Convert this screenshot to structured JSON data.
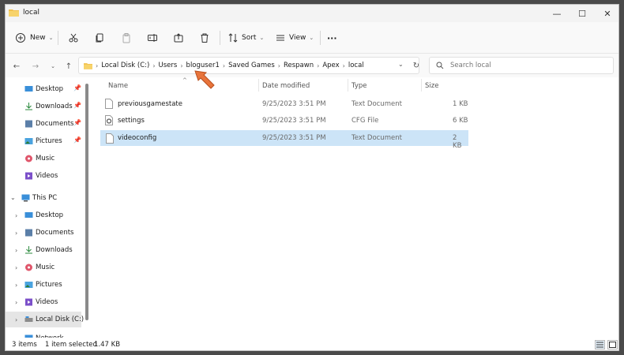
{
  "window": {
    "title": "local",
    "controls": {
      "minimize": "—",
      "maximize": "☐",
      "close": "✕"
    }
  },
  "toolbar": {
    "new_label": "New",
    "sort_label": "Sort",
    "view_label": "View",
    "more_label": "···"
  },
  "address": {
    "crumbs": [
      "Local Disk (C:)",
      "Users",
      "bloguser1",
      "Saved Games",
      "Respawn",
      "Apex",
      "local"
    ],
    "search_placeholder": "Search local"
  },
  "navpane": {
    "quick_access": [
      {
        "label": "Desktop",
        "icon": "desktop-icon",
        "pinned": true
      },
      {
        "label": "Downloads",
        "icon": "download-icon",
        "pinned": true
      },
      {
        "label": "Documents",
        "icon": "documents-icon",
        "pinned": true
      },
      {
        "label": "Pictures",
        "icon": "pictures-icon",
        "pinned": true
      },
      {
        "label": "Music",
        "icon": "music-icon",
        "pinned": false
      },
      {
        "label": "Videos",
        "icon": "videos-icon",
        "pinned": false
      }
    ],
    "this_pc": "This PC",
    "this_pc_children": [
      {
        "label": "Desktop",
        "icon": "desktop-icon"
      },
      {
        "label": "Documents",
        "icon": "documents-icon"
      },
      {
        "label": "Downloads",
        "icon": "download-icon"
      },
      {
        "label": "Music",
        "icon": "music-icon"
      },
      {
        "label": "Pictures",
        "icon": "pictures-icon"
      },
      {
        "label": "Videos",
        "icon": "videos-icon"
      },
      {
        "label": "Local Disk (C:)",
        "icon": "drive-icon"
      }
    ],
    "network": "Network"
  },
  "columns": {
    "name": "Name",
    "date": "Date modified",
    "type": "Type",
    "size": "Size"
  },
  "files": [
    {
      "name": "previousgamestate",
      "date": "9/25/2023 3:51 PM",
      "type": "Text Document",
      "size": "1 KB",
      "icon": "text-file-icon",
      "selected": false
    },
    {
      "name": "settings",
      "date": "9/25/2023 3:51 PM",
      "type": "CFG File",
      "size": "6 KB",
      "icon": "cfg-file-icon",
      "selected": false
    },
    {
      "name": "videoconfig",
      "date": "9/25/2023 3:51 PM",
      "type": "Text Document",
      "size": "2 KB",
      "icon": "text-file-icon",
      "selected": true
    }
  ],
  "status": {
    "items": "3 items",
    "selected": "1 item selected",
    "size": "1.47 KB"
  },
  "colors": {
    "selection": "#cce4f7",
    "accent": "#0067c0",
    "arrow": "#e8743b"
  }
}
